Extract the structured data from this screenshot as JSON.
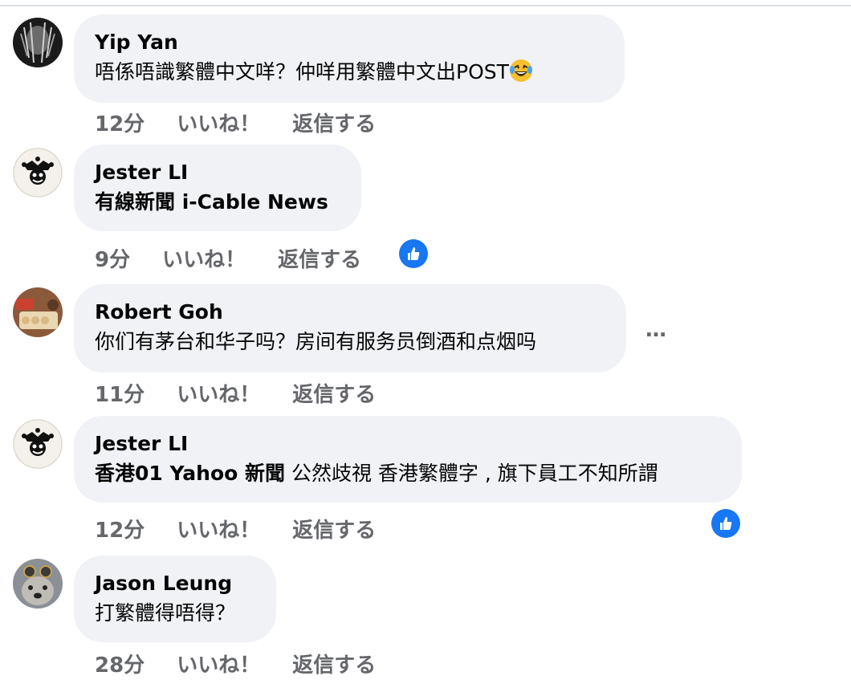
{
  "comments": [
    {
      "author": "Yip Yan",
      "text": "唔係唔識繁體中文咩？仲咩用繁體中文出POST",
      "emoji": "laughing-tears-emoji",
      "time": "12分",
      "like": "いいね！",
      "reply": "返信する"
    },
    {
      "author": "Jester LI",
      "text_bold": "有線新聞 i-Cable News",
      "time": "9分",
      "like": "いいね！",
      "reply": "返信する",
      "reaction": "like-icon"
    },
    {
      "author": "Robert Goh",
      "text": "你们有茅台和华子吗？房间有服务员倒酒和点烟吗",
      "time": "11分",
      "like": "いいね！",
      "reply": "返信する",
      "more": "…"
    },
    {
      "author": "Jester LI",
      "text_bold": "香港01 Yahoo 新聞",
      "text": " 公然歧視 香港繁體字 , 旗下員工不知所謂",
      "time": "12分",
      "like": "いいね！",
      "reply": "返信する",
      "reaction": "like-icon"
    },
    {
      "author": "Jason Leung",
      "text": "打繁體得唔得？",
      "time": "28分",
      "like": "いいね！",
      "reply": "返信する"
    }
  ],
  "colors": {
    "bubble": "#f0f2f5",
    "meta": "#65676b",
    "like_blue": "#1877f2"
  }
}
